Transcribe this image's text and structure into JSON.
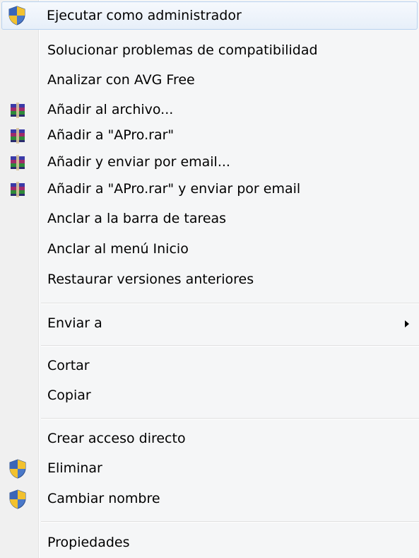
{
  "menu": {
    "items": [
      {
        "label": "Ejecutar como administrador",
        "icon": "uac-shield-icon"
      },
      {
        "label": "Solucionar problemas de compatibilidad"
      },
      {
        "label": "Analizar con AVG Free"
      },
      {
        "label": "Añadir al archivo...",
        "icon": "winrar-archive-icon"
      },
      {
        "label": "Añadir a \"APro.rar\"",
        "icon": "winrar-archive-icon"
      },
      {
        "label": "Añadir y enviar por email...",
        "icon": "winrar-archive-icon"
      },
      {
        "label": "Añadir a \"APro.rar\" y enviar por email",
        "icon": "winrar-archive-icon"
      },
      {
        "label": "Anclar a la barra de tareas"
      },
      {
        "label": "Anclar al menú Inicio"
      },
      {
        "label": "Restaurar versiones anteriores"
      },
      {
        "label": "Enviar a",
        "submenu": true
      },
      {
        "label": "Cortar"
      },
      {
        "label": "Copiar"
      },
      {
        "label": "Crear acceso directo"
      },
      {
        "label": "Eliminar",
        "icon": "uac-shield-icon"
      },
      {
        "label": "Cambiar nombre",
        "icon": "uac-shield-icon"
      },
      {
        "label": "Propiedades"
      }
    ]
  },
  "colors": {
    "menu_background": "#f5f6f7",
    "highlight_border": "#b8d2ef",
    "text": "#000000"
  }
}
